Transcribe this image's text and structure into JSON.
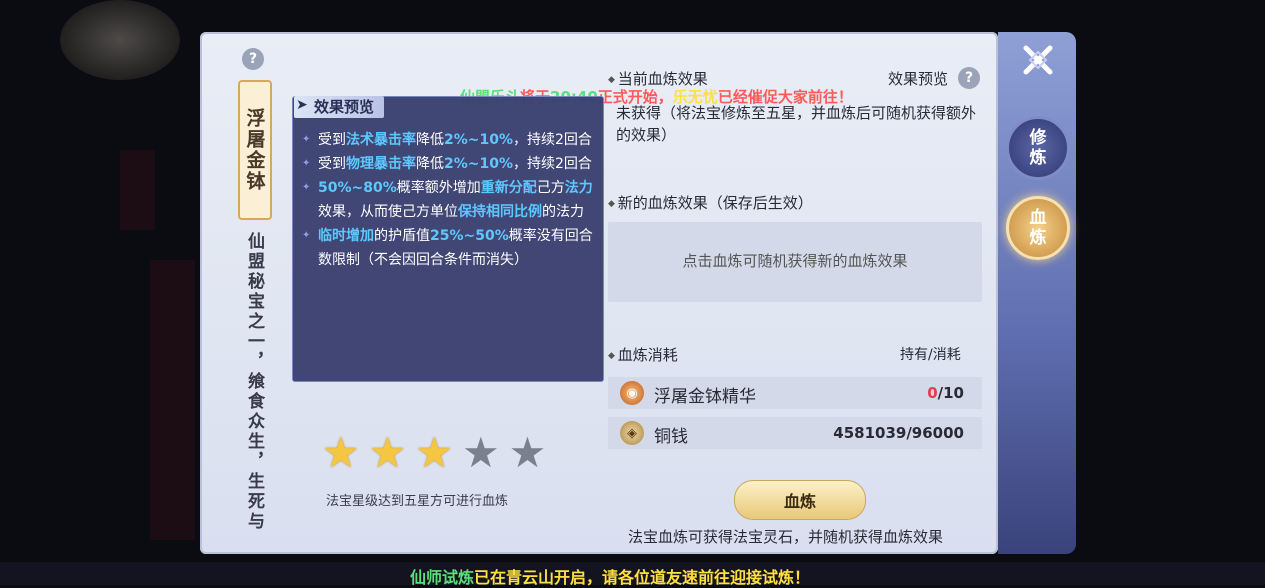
{
  "treasure": {
    "name": "浮屠金钵",
    "description": "仙盟秘宝之一，飨食众生，生死与共"
  },
  "help_icon": "?",
  "close_icon": "close-x-icon",
  "side_tabs": [
    {
      "label": "修炼"
    },
    {
      "label": "血炼"
    }
  ],
  "tooltip": {
    "title": "效果预览",
    "items": [
      [
        {
          "t": "受到"
        },
        {
          "t": "法术暴击率",
          "h": true
        },
        {
          "t": "降低"
        },
        {
          "t": "2%~10%",
          "h": true
        },
        {
          "t": "，持续2回合"
        }
      ],
      [
        {
          "t": "受到"
        },
        {
          "t": "物理暴击率",
          "h": true
        },
        {
          "t": "降低"
        },
        {
          "t": "2%~10%",
          "h": true
        },
        {
          "t": "，持续2回合"
        }
      ],
      [
        {
          "t": "50%~80%",
          "h": true
        },
        {
          "t": "概率额外增加"
        },
        {
          "t": "重新分配",
          "h": true
        },
        {
          "t": "己方"
        },
        {
          "t": "法力",
          "h": true
        },
        {
          "t": "效果，从而使己方单位"
        },
        {
          "t": "保持相同比例",
          "h": true
        },
        {
          "t": "的法力"
        }
      ],
      [
        {
          "t": "临时增加",
          "h": true
        },
        {
          "t": "的护盾值"
        },
        {
          "t": "25%~50%",
          "h": true
        },
        {
          "t": "概率没有回合数限制（不会因回合条件而消失）"
        }
      ]
    ]
  },
  "stars": {
    "earned": 3,
    "total": 5,
    "note": "法宝星级达到五星方可进行血炼"
  },
  "current_effect": {
    "label": "当前血炼效果",
    "preview_label": "效果预览",
    "text": "未获得（将法宝修炼至五星，并血炼后可随机获得额外的效果）"
  },
  "marquee": [
    {
      "t": "仙盟乐斗",
      "c": "#5ae07a"
    },
    {
      "t": "将于",
      "c": "#ff5a5a"
    },
    {
      "t": "20:40",
      "c": "#5ae07a"
    },
    {
      "t": "正式开始，",
      "c": "#ff5a5a"
    },
    {
      "t": "乐无忧",
      "c": "#ffe040"
    },
    {
      "t": "已经催促大家前往！",
      "c": "#ff5a5a"
    }
  ],
  "new_effect": {
    "label": "新的血炼效果（保存后生效）",
    "placeholder": "点击血炼可随机获得新的血炼效果"
  },
  "cost": {
    "label": "血炼消耗",
    "header_right": "持有/消耗",
    "items": [
      {
        "name": "浮屠金钵精华",
        "held": "0",
        "need": "/10",
        "held_color": "#e0404a",
        "icon": "essence-bowl-icon"
      },
      {
        "name": "铜钱",
        "held": "4581039",
        "need": "/96000",
        "held_color": "#2a2a36",
        "icon": "copper-coin-icon"
      }
    ]
  },
  "refine_button": "血炼",
  "footer_note": "法宝血炼可获得法宝灵石，并随机获得血炼效果",
  "bottom_banner": [
    {
      "t": "仙师试炼",
      "c": "#5ae07a"
    },
    {
      "t": "已在",
      "c": "#ffe040"
    },
    {
      "t": "青云山",
      "c": "#ffe040"
    },
    {
      "t": "开启，请各位道友速前往迎接试炼！",
      "c": "#ffe040"
    }
  ]
}
